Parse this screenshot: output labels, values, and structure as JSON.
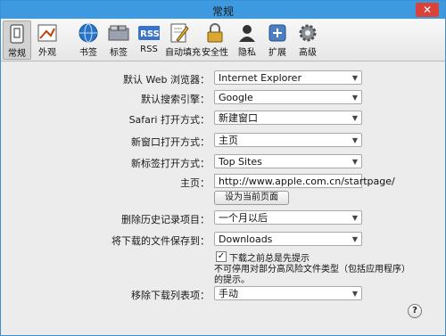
{
  "window": {
    "title": "常规",
    "close_glyph": "✕"
  },
  "toolbar": {
    "items": [
      {
        "label": "常规",
        "icon": "switch-icon",
        "selected": true
      },
      {
        "label": "外观",
        "icon": "appearance-icon"
      },
      {
        "label": "书签",
        "icon": "bookmarks-globe-icon"
      },
      {
        "label": "标签",
        "icon": "tabs-icon"
      },
      {
        "label": "RSS",
        "icon": "rss-icon"
      },
      {
        "label": "自动填充",
        "icon": "autofill-pen-icon"
      },
      {
        "label": "安全性",
        "icon": "lock-icon"
      },
      {
        "label": "隐私",
        "icon": "privacy-person-icon"
      },
      {
        "label": "扩展",
        "icon": "extensions-puzzle-icon"
      },
      {
        "label": "高级",
        "icon": "gear-icon"
      }
    ]
  },
  "settings": {
    "default_browser": {
      "label": "默认 Web 浏览器：",
      "value": "Internet Explorer"
    },
    "search_engine": {
      "label": "默认搜索引擎：",
      "value": "Google"
    },
    "safari_open": {
      "label": "Safari 打开方式：",
      "value": "新建窗口"
    },
    "new_window_open": {
      "label": "新窗口打开方式：",
      "value": "主页"
    },
    "new_tab_open": {
      "label": "新标签打开方式：",
      "value": "Top Sites"
    },
    "homepage": {
      "label": "主页：",
      "value": "http://www.apple.com.cn/startpage/",
      "set_current_button": "设为当前页面"
    },
    "remove_history": {
      "label": "删除历史记录项目：",
      "value": "一个月以后"
    },
    "save_downloads": {
      "label": "将下载的文件保存到：",
      "value": "Downloads"
    },
    "open_safe_files": {
      "checked": true,
      "check_glyph": "✓",
      "label": "下载之前总是先提示",
      "note_line1": "不可停用对部分高风险文件类型（包括应用程序）",
      "note_line2": "的提示。"
    },
    "remove_download_list": {
      "label": "移除下载列表项：",
      "value": "手动"
    }
  },
  "help": {
    "glyph": "?"
  }
}
